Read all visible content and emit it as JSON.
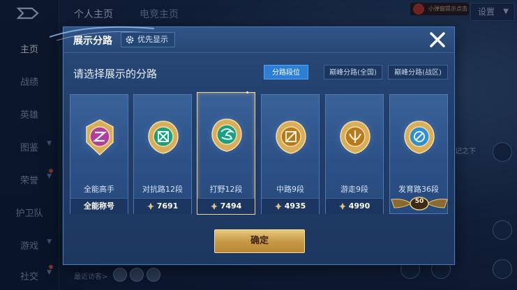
{
  "nav": {
    "items": [
      {
        "label": "主页",
        "active": true
      },
      {
        "label": "战绩"
      },
      {
        "label": "英雄"
      },
      {
        "label": "图鉴"
      },
      {
        "label": "荣誉"
      },
      {
        "label": "护卫队"
      },
      {
        "label": "游戏"
      },
      {
        "label": "社交"
      }
    ]
  },
  "tabs": [
    {
      "label": "个人主页",
      "active": true
    },
    {
      "label": "电竞主页"
    }
  ],
  "top_right": {
    "notif_text": "小弹窗提示点击",
    "settings_label": "设置"
  },
  "bottom": {
    "visitors_label": "最近访客>"
  },
  "bg_right": {
    "note": "记之下"
  },
  "modal": {
    "title": "展示分路",
    "priority_label": "优先显示",
    "subtitle": "请选择展示的分路",
    "segments": [
      {
        "label": "分路段位",
        "active": true
      },
      {
        "label": "巅峰分路(全国)"
      },
      {
        "label": "巅峰分路(战区)"
      }
    ],
    "cards": [
      {
        "name": "全能高手",
        "footer": "全能称号",
        "emblem": "all-round-emblem-icon",
        "color": "#b13da3"
      },
      {
        "name": "对抗路12段",
        "points": "7691",
        "emblem": "clash-lane-emblem-icon",
        "color": "#1aa07a"
      },
      {
        "name": "打野12段",
        "points": "7494",
        "emblem": "jungle-emblem-icon",
        "color": "#1a9f86",
        "selected": true
      },
      {
        "name": "中路9段",
        "points": "4935",
        "emblem": "mid-lane-emblem-icon",
        "color": "#b8781c"
      },
      {
        "name": "游走9段",
        "points": "4990",
        "emblem": "roam-emblem-icon",
        "color": "#b8781c"
      },
      {
        "name": "发育路36段",
        "level": "50",
        "emblem": "farm-lane-emblem-icon",
        "color": "#2d8fd8"
      }
    ],
    "confirm_label": "确定"
  },
  "colors": {
    "accent": "#2b7fd6",
    "gold": "#e7c77e",
    "panel": "#2a4a79"
  }
}
